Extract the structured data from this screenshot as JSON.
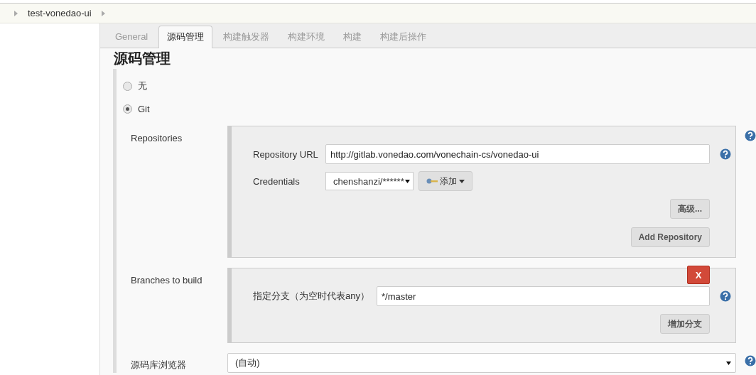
{
  "breadcrumb": {
    "item": "test-vonedao-ui"
  },
  "tabs": [
    {
      "label": "General",
      "selected": false
    },
    {
      "label": "源码管理",
      "selected": true
    },
    {
      "label": "构建触发器",
      "selected": false
    },
    {
      "label": "构建环境",
      "selected": false
    },
    {
      "label": "构建",
      "selected": false
    },
    {
      "label": "构建后操作",
      "selected": false
    }
  ],
  "heading": "源码管理",
  "scm_options": [
    {
      "label": "无",
      "selected": false
    },
    {
      "label": "Git",
      "selected": true
    }
  ],
  "repositories": {
    "label": "Repositories",
    "url_label": "Repository URL",
    "url_value": "http://gitlab.vonedao.com/vonechain-cs/vonedao-ui",
    "credentials_label": "Credentials",
    "credentials_value": "chenshanzi/******",
    "add_button": "添加",
    "advanced_button": "高级...",
    "add_repository_button": "Add Repository"
  },
  "branches": {
    "label": "Branches to build",
    "branch_label": "指定分支（为空时代表any）",
    "branch_value": "*/master",
    "delete_button": "X",
    "add_branch_button": "增加分支"
  },
  "browser": {
    "label": "源码库浏览器",
    "value": "(自动)"
  }
}
